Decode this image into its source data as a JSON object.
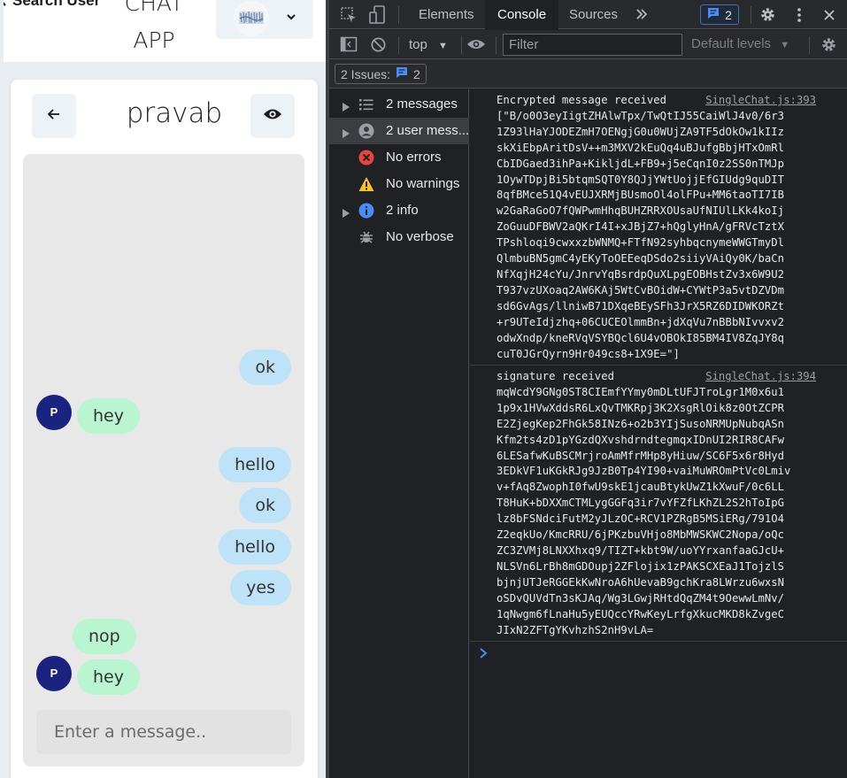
{
  "app": {
    "search_label": "Search User",
    "title_line1": "CHAT",
    "title_line2": "APP",
    "chat_name": "pravab",
    "input_placeholder": "Enter a message..",
    "avatar_initial": "P",
    "messages": [
      {
        "text": "ok",
        "dir": "out"
      },
      {
        "text": "hey",
        "dir": "in"
      },
      {
        "text": "hello",
        "dir": "out"
      },
      {
        "text": "ok",
        "dir": "out"
      },
      {
        "text": "hello",
        "dir": "out"
      },
      {
        "text": "yes",
        "dir": "out"
      },
      {
        "text": "nop",
        "dir": "in"
      },
      {
        "text": "hey",
        "dir": "in"
      }
    ]
  },
  "devtools": {
    "tabs": [
      "Elements",
      "Console",
      "Sources"
    ],
    "active_tab": "Console",
    "issues_badge_count": "2",
    "context": "top",
    "filter_placeholder": "Filter",
    "levels": "Default levels",
    "issues_label": "2 Issues:",
    "issues_count": "2",
    "sidebar": [
      {
        "label": "2 messages",
        "icon": "list-icon",
        "expandable": true
      },
      {
        "label": "2 user mess...",
        "icon": "user-icon",
        "expandable": true,
        "selected": true
      },
      {
        "label": "No errors",
        "icon": "error-icon",
        "expandable": false
      },
      {
        "label": "No warnings",
        "icon": "warning-icon",
        "expandable": false
      },
      {
        "label": "2 info",
        "icon": "info-icon",
        "expandable": true
      },
      {
        "label": "No verbose",
        "icon": "bug-icon",
        "expandable": false
      }
    ],
    "logs": [
      {
        "source": "SingleChat.js:393",
        "text": "Encrypted message received\n[\"B/o0O3eyIigtZHAlwTpx/TwQtIJ55CaiWlJ4v0/6r3\n1Z93lHaYJODEZmH7OENgjG0u0WUjZA9TF5dOkOw1kIIz\nskXiEbpAritDsV++m3MXV2kEuQq4uBJufgBbjHTxOmRl\nCbIDGaed3ihPa+KikljdL+FB9+j5eCqnI0z2SS0nTMJp\n1OywTDpjBi5btqmSQT0Y8QJjYWtUojjEfGIUdg9quDIT\n8qfBMce51Q4vEUJXRMjBUsmoOl4olFPu+MM6taoTI7IB\nw2GaRaGoO7fQWPwmHhqBUHZRRXOUsaUfNIUlLKk4koIj\nZoGuuDFBWV2aQKrI4I+xJBjZ7+hQglyHnA/gFRVcTztX\nTPshloqi9cwxxzbWNMQ+FTfN92syhbqcnymeWWGTmyDl\nQlmbuBN5gmC4yEKyToOEEeqDSdo2siiyVAiQy0K/baCn\nNfXqjH24cYu/JnrvYqBsrdpQuXLpgEOBHstZv3x6W9U2\nT937vzUXoaq2AW6KAj5WtCvBOidW+CYWtP3a5vtDZVDm\nsd6GvAgs/llniwB71DXqeBEySFh3JrX5RZ6DIDWKORZt\n+r9UTeIdjzhq+06CUCEOlmmBn+jdXqVu7nBBbNIvvxv2\nodwXndp/kneRVqVSYBQcl6U4vOBOkI85BM4IV8ZqJY8q\ncuT0JGrQyrn9Hr049cs8+1X9E=\"]"
      },
      {
        "source": "SingleChat.js:394",
        "text": "signature received\nmqWcdY9GNg0ST8CIEmfYYmy0mDLtUFJTroLgr1M0x6u1\n1p9x1HVwXddsR6LxQvTMKRpj3K2XsgRlOik8z0OtZCPR\nE2ZjegKep2FhGk58INz6+o2b3YIjSusoNRMUpNubqASn\nKfm2ts4zD1pYGzdQXvshdrndtegmqxIDnUI2RIR8CAFw\n6LESafwKuBSCMrjroAmMfrMHp8yHiuw/SC6F5x6r8Hyd\n3EDkVF1uKGkRJg9JzB0Tp4YI90+vaiMuWROmPtVc0Lmiv\nv+fAq8ZwophI0fwU9skE1jcauBtykUwZ1kXwuF/0c6LL\nT8HuK+bDXXmCTMLygGGFq3ir7vYFZfLKhZL2S2hToIpG\nlz8bFSNdciFutM2yJLzOC+RCV1PZRgB5MSiERg/791O4\nZ2eqkUo/KmcRRU/6jPKzbuVHjo8MbMWSKWC2Nopa/oQc\nZC3ZVMj8LNXXhxq9/TIZT+kbt9W/uoYYrxanfaaGJcU+\nNLSVn6LrBh8mGDOupj2ZFlojix1zPAKSCXEaJ1TojzlS\nbjnjUTJeRGGEkKwNroA6hUevaB9gchKra8LWrzu6wxsN\noSDvQUVdTn3sKJAq/Wg3LGwjRHtdQqZM4t9OewwLmNv/\n1qNwgm6fLnaHu5yEUQccYRwKeyLrfgXkucMKD8kZvgeC\nJIxN2ZFTgYKvhzhS2nH9vLA="
      }
    ]
  }
}
